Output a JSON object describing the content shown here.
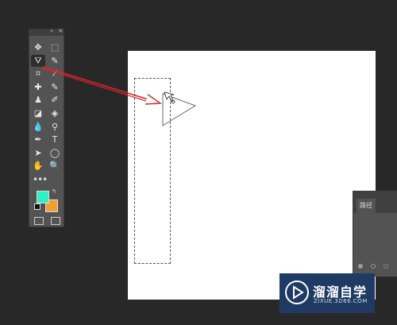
{
  "toolbar": {
    "collapse_glyph": "«",
    "close_glyph": "×",
    "tools": [
      {
        "icon": "move-icon",
        "glyph": "✥"
      },
      {
        "icon": "rect-marquee-icon",
        "glyph": "⬚"
      },
      {
        "icon": "polygonal-lasso-icon",
        "glyph": "⛛",
        "active": true
      },
      {
        "icon": "quick-select-icon",
        "glyph": "✎"
      },
      {
        "icon": "crop-icon",
        "glyph": "⌗"
      },
      {
        "icon": "eyedropper-icon",
        "glyph": "⁄"
      },
      {
        "icon": "healing-brush-icon",
        "glyph": "✚"
      },
      {
        "icon": "brush-icon",
        "glyph": "✎"
      },
      {
        "icon": "clone-stamp-icon",
        "glyph": "♟"
      },
      {
        "icon": "history-brush-icon",
        "glyph": "✐"
      },
      {
        "icon": "eraser-icon",
        "glyph": "◪"
      },
      {
        "icon": "paint-bucket-icon",
        "glyph": "◈"
      },
      {
        "icon": "blur-icon",
        "glyph": "💧"
      },
      {
        "icon": "dodge-icon",
        "glyph": "⚲"
      },
      {
        "icon": "pen-icon",
        "glyph": "✒"
      },
      {
        "icon": "type-icon",
        "glyph": "T"
      },
      {
        "icon": "path-select-icon",
        "glyph": "➤"
      },
      {
        "icon": "ellipse-icon",
        "glyph": "◯"
      },
      {
        "icon": "hand-icon",
        "glyph": "✋"
      },
      {
        "icon": "zoom-icon",
        "glyph": "🔍"
      }
    ],
    "more_glyph": "•••",
    "foreground_color": "#2ef0c4",
    "background_color": "#f0a030"
  },
  "paths_panel": {
    "tab_label": "路径"
  },
  "watermark": {
    "title": "溜溜自学",
    "url": "ZIXUE.3D66.COM"
  },
  "colors": {
    "arrow": "#d9262c",
    "canvas": "#ffffff",
    "workspace": "#282828"
  }
}
